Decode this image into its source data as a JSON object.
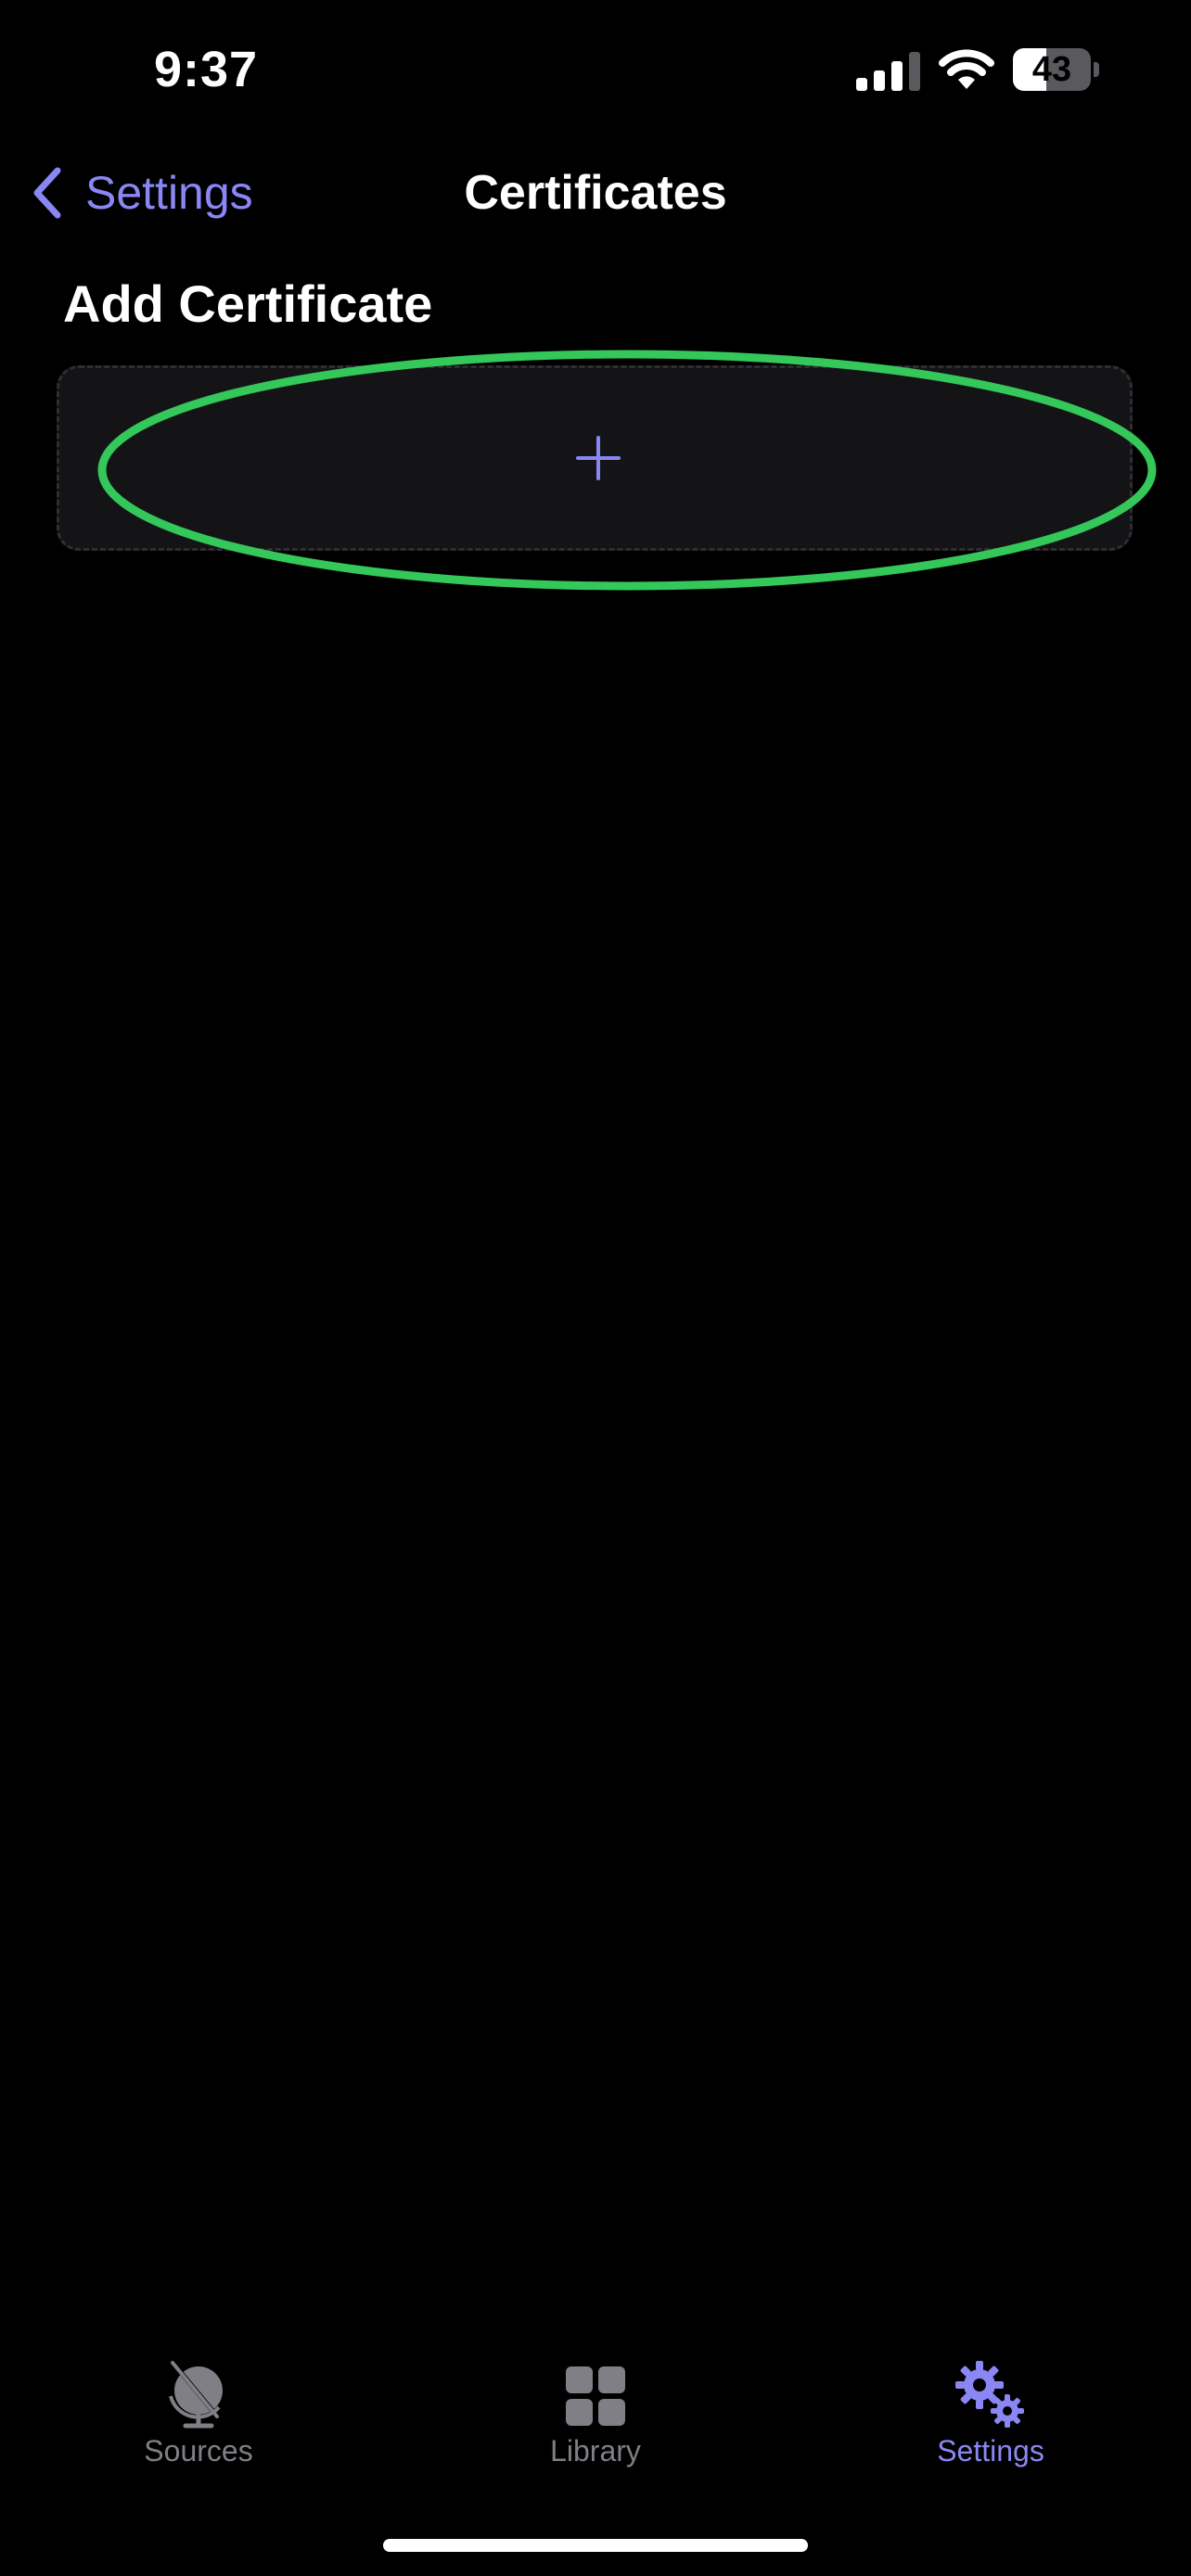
{
  "status_bar": {
    "time": "9:37",
    "battery_level": "43",
    "battery_fraction": 0.43,
    "icons": [
      "cellular-signal-icon",
      "wifi-icon",
      "battery-icon"
    ]
  },
  "nav": {
    "back_label": "Settings",
    "title": "Certificates",
    "back_icon": "chevron-left-icon"
  },
  "section": {
    "header": "Add Certificate",
    "add_icon": "plus-icon",
    "highlight_color": "#34c759"
  },
  "tab_bar": {
    "tabs": [
      {
        "label": "Sources",
        "icon": "globe-icon",
        "active": false
      },
      {
        "label": "Library",
        "icon": "grid-icon",
        "active": false
      },
      {
        "label": "Settings",
        "icon": "gears-icon",
        "active": true
      }
    ]
  },
  "colors": {
    "accent": "#8a87f5",
    "background": "#000000",
    "card": "#141417",
    "inactive": "#7f7f85"
  }
}
